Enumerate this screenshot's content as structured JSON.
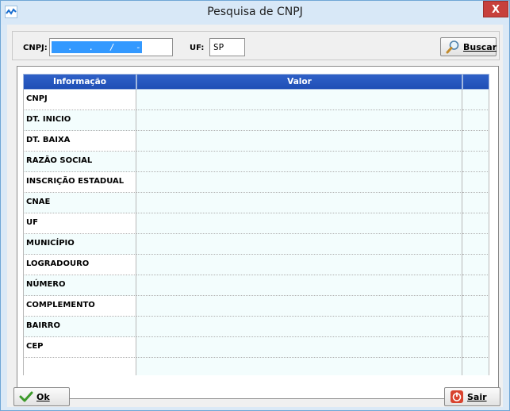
{
  "window": {
    "title": "Pesquisa de CNPJ",
    "close_label": "X"
  },
  "search": {
    "cnpj_label": "CNPJ:",
    "cnpj_value": "   .   .   /    -  ",
    "uf_label": "UF:",
    "uf_value": "SP",
    "buscar_label": "Buscar"
  },
  "grid": {
    "headers": [
      "Informação",
      "Valor",
      ""
    ],
    "rows": [
      {
        "info": "CNPJ",
        "valor": ""
      },
      {
        "info": "DT. INICIO",
        "valor": ""
      },
      {
        "info": "DT. BAIXA",
        "valor": ""
      },
      {
        "info": "RAZÃO SOCIAL",
        "valor": ""
      },
      {
        "info": "INSCRIÇÃO ESTADUAL",
        "valor": ""
      },
      {
        "info": "CNAE",
        "valor": ""
      },
      {
        "info": "UF",
        "valor": ""
      },
      {
        "info": "MUNICÍPIO",
        "valor": ""
      },
      {
        "info": "LOGRADOURO",
        "valor": ""
      },
      {
        "info": "NÚMERO",
        "valor": ""
      },
      {
        "info": "COMPLEMENTO",
        "valor": ""
      },
      {
        "info": "BAIRRO",
        "valor": ""
      },
      {
        "info": "CEP",
        "valor": ""
      }
    ]
  },
  "footer": {
    "ok_label": "Ok",
    "sair_label": "Sair"
  },
  "colors": {
    "header_bg": "#2357be",
    "row_bg": "#f3fdfd",
    "selection": "#3399ff",
    "close_btn": "#c7403c"
  }
}
